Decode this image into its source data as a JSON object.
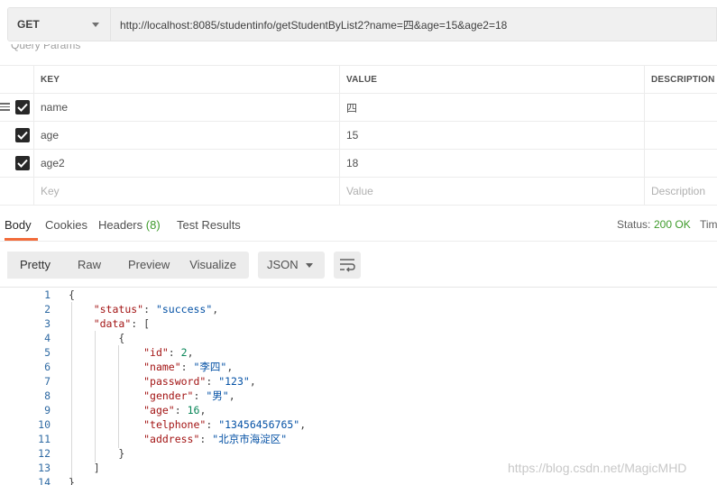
{
  "request": {
    "method": "GET",
    "url": "http://localhost:8085/studentinfo/getStudentByList2?name=四&age=15&age2=18"
  },
  "query_params": {
    "title": "Query Params",
    "headers": {
      "key": "KEY",
      "value": "VALUE",
      "description": "DESCRIPTION"
    },
    "rows": [
      {
        "key": "name",
        "value": "四",
        "checked": true
      },
      {
        "key": "age",
        "value": "15",
        "checked": true
      },
      {
        "key": "age2",
        "value": "18",
        "checked": true
      }
    ],
    "placeholders": {
      "key": "Key",
      "value": "Value",
      "description": "Description"
    }
  },
  "response_tabs": {
    "body": "Body",
    "cookies": "Cookies",
    "headers": "Headers",
    "headers_count": "(8)",
    "test_results": "Test Results",
    "status_label": "Status:",
    "status_value": "200 OK",
    "time_label": "Tim"
  },
  "body_toolbar": {
    "views": [
      "Pretty",
      "Raw",
      "Preview",
      "Visualize"
    ],
    "format": "JSON"
  },
  "code": {
    "lines": [
      {
        "n": "1",
        "text": "{"
      },
      {
        "n": "2",
        "text": "    \"status\": \"success\","
      },
      {
        "n": "3",
        "text": "    \"data\": ["
      },
      {
        "n": "4",
        "text": "        {"
      },
      {
        "n": "5",
        "text": "            \"id\": 2,"
      },
      {
        "n": "6",
        "text": "            \"name\": \"李四\","
      },
      {
        "n": "7",
        "text": "            \"password\": \"123\","
      },
      {
        "n": "8",
        "text": "            \"gender\": \"男\","
      },
      {
        "n": "9",
        "text": "            \"age\": 16,"
      },
      {
        "n": "10",
        "text": "            \"telphone\": \"13456456765\","
      },
      {
        "n": "11",
        "text": "            \"address\": \"北京市海淀区\""
      },
      {
        "n": "12",
        "text": "        }"
      },
      {
        "n": "13",
        "text": "    ]"
      },
      {
        "n": "14",
        "text": "}"
      }
    ]
  },
  "watermark": "https://blog.csdn.net/MagicMHD",
  "colors": {
    "accent": "#f26b3a",
    "ok": "#3f9b2c",
    "json_key": "#a31515",
    "json_string": "#0451a5",
    "json_number": "#098658",
    "line_number": "#2f6aa3"
  }
}
